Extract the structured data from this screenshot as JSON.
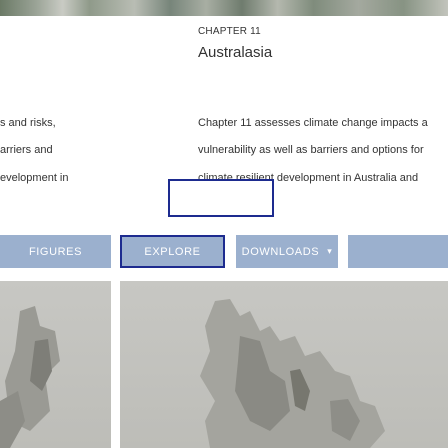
{
  "left_column": {
    "lines": [
      "s and risks,",
      "arriers and",
      "evelopment in"
    ]
  },
  "chapter": {
    "number": "CHAPTER 11",
    "title": "Australasia",
    "description_lines": [
      "Chapter 11 assesses climate change impacts a",
      "vulnerability as well as barriers and options for",
      "climate resilient development in Australia and"
    ]
  },
  "buttons": {
    "figures": "FIGURES",
    "explore": "EXPLORE",
    "downloads": "DOWNLOADS",
    "downloads_caret": "▾"
  },
  "colors": {
    "button_bg": "#9bb0ce",
    "focus_outline": "#1d2b8f"
  }
}
